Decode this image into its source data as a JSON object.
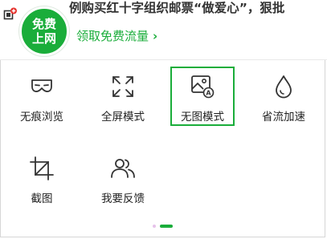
{
  "header": {
    "headline": "例购买红十字组织邮票“做爱心”，狠批",
    "badge_line1": "免费",
    "badge_line2": "上网",
    "promo_label": "领取免费流量",
    "promo_chevron": "›"
  },
  "grid": {
    "items": [
      {
        "label": "无痕浏览",
        "icon": "mask-icon",
        "selected": false
      },
      {
        "label": "全屏模式",
        "icon": "fullscreen-icon",
        "selected": false
      },
      {
        "label": "无图模式",
        "icon": "no-image-icon",
        "selected": true
      },
      {
        "label": "省流加速",
        "icon": "drop-icon",
        "selected": false
      },
      {
        "label": "截图",
        "icon": "crop-icon",
        "selected": false
      },
      {
        "label": "我要反馈",
        "icon": "users-icon",
        "selected": false
      }
    ]
  },
  "pager": {
    "pages": 2,
    "active_page": 2
  },
  "colors": {
    "accent": "#1aad3a",
    "inactive_dot": "#e7c3ea"
  }
}
